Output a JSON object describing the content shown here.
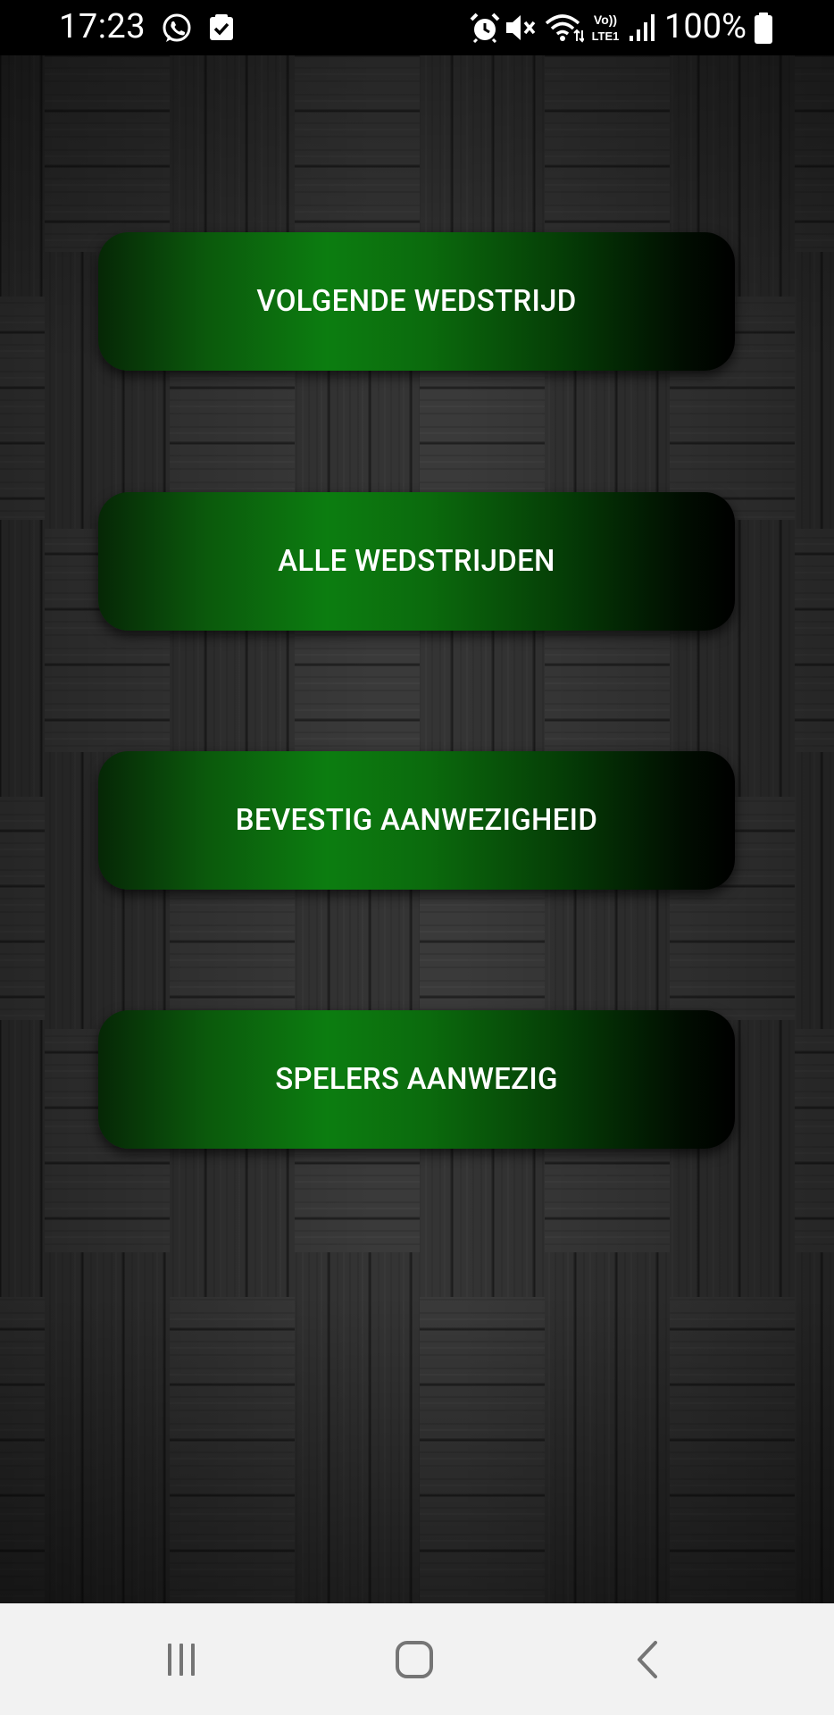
{
  "status_bar": {
    "time": "17:23",
    "battery": "100%",
    "network": "LTE1",
    "icons": [
      "whatsapp-icon",
      "task-check-icon",
      "alarm-icon",
      "mute-icon",
      "wifi-icon",
      "volte-lte-icon",
      "signal-icon",
      "battery-icon"
    ]
  },
  "menu": {
    "buttons": [
      {
        "label": "VOLGENDE WEDSTRIJD"
      },
      {
        "label": "ALLE WEDSTRIJDEN"
      },
      {
        "label": "BEVESTIG AANWEZIGHEID"
      },
      {
        "label": "SPELERS AANWEZIG"
      }
    ]
  },
  "nav_bar": {
    "icons": [
      "recent-apps-icon",
      "home-icon",
      "back-icon"
    ]
  },
  "colors": {
    "button_gradient_start": "#062706",
    "button_gradient_mid": "#0c7d10",
    "button_gradient_end": "#000000",
    "status_bar_bg": "#000000",
    "nav_bar_bg": "#f2f2f2",
    "nav_icon": "#757575"
  }
}
